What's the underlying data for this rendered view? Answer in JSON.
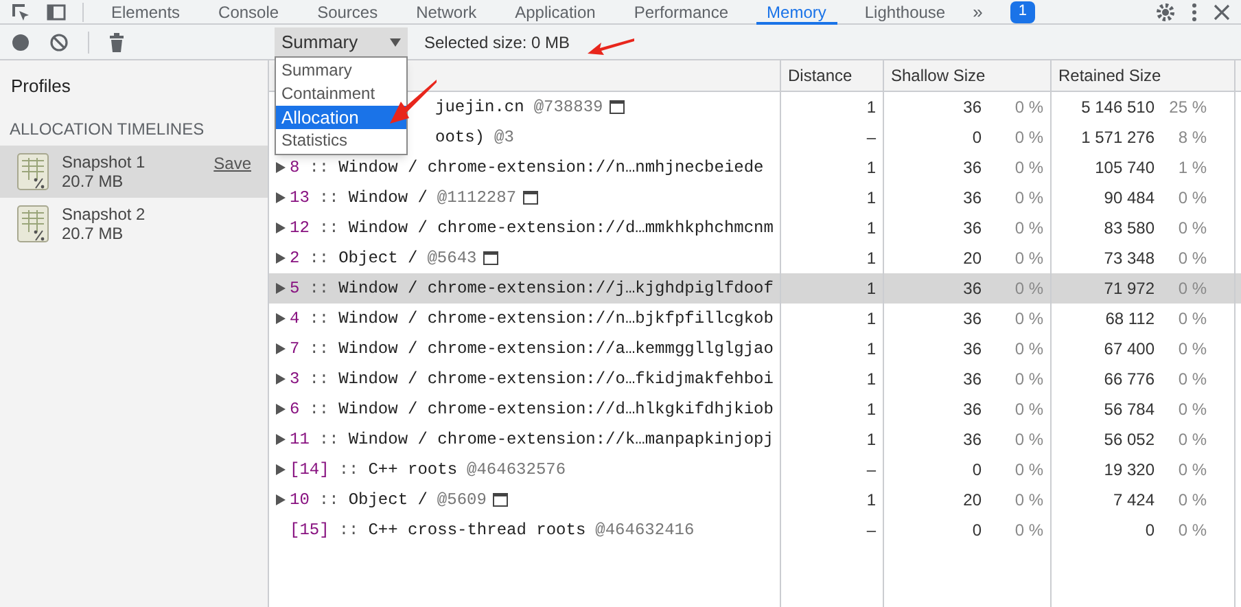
{
  "tabs": [
    {
      "label": "Elements",
      "selected": false
    },
    {
      "label": "Console",
      "selected": false
    },
    {
      "label": "Sources",
      "selected": false
    },
    {
      "label": "Network",
      "selected": false
    },
    {
      "label": "Application",
      "selected": false
    },
    {
      "label": "Performance",
      "selected": false
    },
    {
      "label": "Memory",
      "selected": true
    },
    {
      "label": "Lighthouse",
      "selected": false
    }
  ],
  "more_tabs": "»",
  "issues_badge": "1",
  "toolbar": {
    "view_select": "Summary",
    "selected_size": "Selected size: 0 MB"
  },
  "separator": "::",
  "dropdown": [
    {
      "label": "Summary",
      "selected": false
    },
    {
      "label": "Containment",
      "selected": false
    },
    {
      "label": "Allocation",
      "selected": true
    },
    {
      "label": "Statistics",
      "selected": false
    }
  ],
  "sidebar": {
    "title": "Profiles",
    "section": "ALLOCATION TIMELINES",
    "snapshots": [
      {
        "name": "Snapshot 1",
        "size": "20.7 MB",
        "selected": true,
        "action": "Save"
      },
      {
        "name": "Snapshot 2",
        "size": "20.7 MB",
        "selected": false
      }
    ]
  },
  "table": {
    "columns": [
      "Distance",
      "Shallow Size",
      "Retained Size"
    ],
    "rows": [
      {
        "covered": true,
        "expandable": false,
        "id": "",
        "name": "juejin.cn",
        "address": "@738839",
        "marked": true,
        "distance": "1",
        "shallow": "36",
        "shallow_pct": "0 %",
        "retained": "5 146 510",
        "retained_pct": "25 %",
        "selected": false
      },
      {
        "covered": true,
        "expandable": false,
        "id": "",
        "name": "oots)",
        "address": "@3",
        "marked": false,
        "distance": "–",
        "shallow": "0",
        "shallow_pct": "0 %",
        "retained": "1 571 276",
        "retained_pct": "8 %",
        "selected": false
      },
      {
        "covered": false,
        "expandable": true,
        "id": "8",
        "name": "Window / chrome-extension://n…nmhjnecbeiede",
        "address": "",
        "marked": false,
        "distance": "1",
        "shallow": "36",
        "shallow_pct": "0 %",
        "retained": "105 740",
        "retained_pct": "1 %",
        "selected": false
      },
      {
        "covered": false,
        "expandable": true,
        "id": "13",
        "name": "Window /",
        "address": "@1112287",
        "marked": true,
        "distance": "1",
        "shallow": "36",
        "shallow_pct": "0 %",
        "retained": "90 484",
        "retained_pct": "0 %",
        "selected": false
      },
      {
        "covered": false,
        "expandable": true,
        "id": "12",
        "name": "Window / chrome-extension://d…mmkhkphchmcnm",
        "address": "",
        "marked": false,
        "distance": "1",
        "shallow": "36",
        "shallow_pct": "0 %",
        "retained": "83 580",
        "retained_pct": "0 %",
        "selected": false
      },
      {
        "covered": false,
        "expandable": true,
        "id": "2",
        "name": "Object /",
        "address": "@5643",
        "marked": true,
        "distance": "1",
        "shallow": "20",
        "shallow_pct": "0 %",
        "retained": "73 348",
        "retained_pct": "0 %",
        "selected": false
      },
      {
        "covered": false,
        "expandable": true,
        "id": "5",
        "name": "Window / chrome-extension://j…kjghdpiglfdoof",
        "address": "",
        "marked": false,
        "distance": "1",
        "shallow": "36",
        "shallow_pct": "0 %",
        "retained": "71 972",
        "retained_pct": "0 %",
        "selected": true
      },
      {
        "covered": false,
        "expandable": true,
        "id": "4",
        "name": "Window / chrome-extension://n…bjkfpfillcgkob",
        "address": "",
        "marked": false,
        "distance": "1",
        "shallow": "36",
        "shallow_pct": "0 %",
        "retained": "68 112",
        "retained_pct": "0 %",
        "selected": false
      },
      {
        "covered": false,
        "expandable": true,
        "id": "7",
        "name": "Window / chrome-extension://a…kemmggllglgjao",
        "address": "",
        "marked": false,
        "distance": "1",
        "shallow": "36",
        "shallow_pct": "0 %",
        "retained": "67 400",
        "retained_pct": "0 %",
        "selected": false
      },
      {
        "covered": false,
        "expandable": true,
        "id": "3",
        "name": "Window / chrome-extension://o…fkidjmakfehboi",
        "address": "",
        "marked": false,
        "distance": "1",
        "shallow": "36",
        "shallow_pct": "0 %",
        "retained": "66 776",
        "retained_pct": "0 %",
        "selected": false
      },
      {
        "covered": false,
        "expandable": true,
        "id": "6",
        "name": "Window / chrome-extension://d…hlkgkifdhjkiob",
        "address": "",
        "marked": false,
        "distance": "1",
        "shallow": "36",
        "shallow_pct": "0 %",
        "retained": "56 784",
        "retained_pct": "0 %",
        "selected": false
      },
      {
        "covered": false,
        "expandable": true,
        "id": "11",
        "name": "Window / chrome-extension://k…manpapkinjopj",
        "address": "",
        "marked": false,
        "distance": "1",
        "shallow": "36",
        "shallow_pct": "0 %",
        "retained": "56 052",
        "retained_pct": "0 %",
        "selected": false
      },
      {
        "covered": false,
        "expandable": true,
        "id": "[14]",
        "name": "C++ roots",
        "address": "@464632576",
        "marked": false,
        "distance": "–",
        "shallow": "0",
        "shallow_pct": "0 %",
        "retained": "19 320",
        "retained_pct": "0 %",
        "selected": false
      },
      {
        "covered": false,
        "expandable": true,
        "id": "10",
        "name": "Object /",
        "address": "@5609",
        "marked": true,
        "distance": "1",
        "shallow": "20",
        "shallow_pct": "0 %",
        "retained": "7 424",
        "retained_pct": "0 %",
        "selected": false
      },
      {
        "covered": false,
        "expandable": false,
        "id": "[15]",
        "name": "C++ cross-thread roots",
        "address": "@464632416",
        "marked": false,
        "distance": "–",
        "shallow": "0",
        "shallow_pct": "0 %",
        "retained": "0",
        "retained_pct": "0 %",
        "selected": false
      }
    ]
  }
}
